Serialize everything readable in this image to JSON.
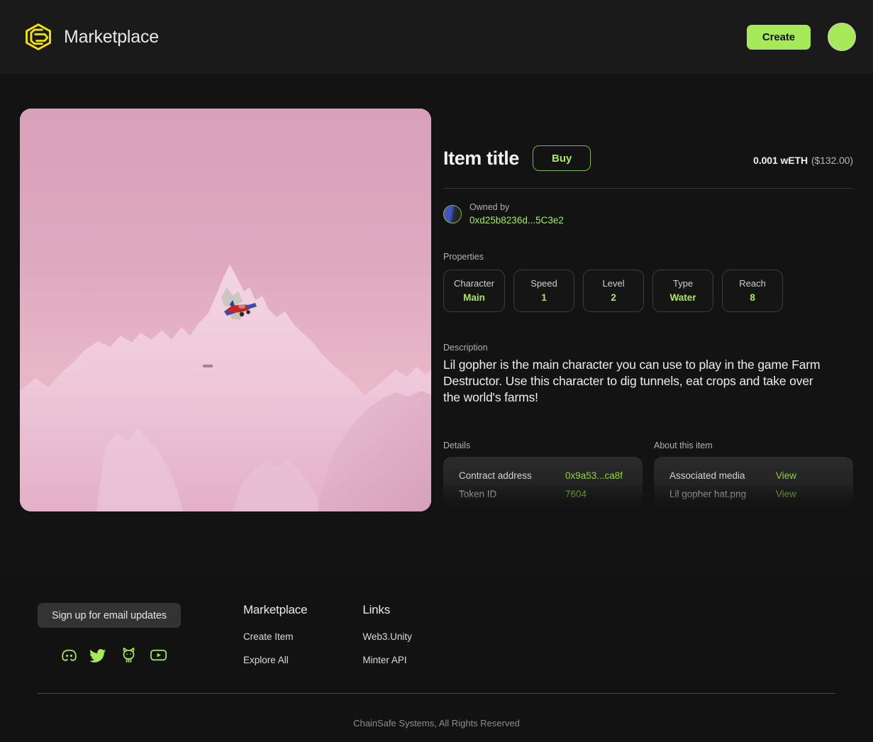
{
  "header": {
    "logo_icon": "chainsafe-hexagon-logo",
    "brand_title": "Marketplace",
    "create_label": "Create",
    "avatar_icon": "user-avatar"
  },
  "media": {
    "alt": "low-poly pink mountain landscape with red airplane",
    "sky_color": "#d8a0b9",
    "mountain_color": "#f0cbdc",
    "plane_body_color": "#cc2222",
    "plane_wing_color": "#3a4ba8"
  },
  "item": {
    "title": "Item title",
    "buy_label": "Buy",
    "price_crypto": "0.001 wETH",
    "price_fiat": "($132.00)",
    "owned_by_label": "Owned by",
    "owner_address": "0xd25b8236d...5C3e2"
  },
  "properties": {
    "label": "Properties",
    "items": [
      {
        "key": "Character",
        "value": "Main"
      },
      {
        "key": "Speed",
        "value": "1"
      },
      {
        "key": "Level",
        "value": "2"
      },
      {
        "key": "Type",
        "value": "Water"
      },
      {
        "key": "Reach",
        "value": "8"
      }
    ]
  },
  "description": {
    "label": "Description",
    "text": "Lil gopher is the main character you can use to play in the game Farm Destructor. Use this character to dig tunnels, eat crops and take over the world's farms!"
  },
  "details": {
    "title": "Details",
    "rows": [
      {
        "key": "Contract address",
        "value": "0x9a53...ca8f"
      },
      {
        "key": "Token ID",
        "value": "7604"
      }
    ]
  },
  "about": {
    "title": "About this item",
    "rows": [
      {
        "key": "Associated media",
        "value": "View"
      },
      {
        "key": "Lil gopher hat.png",
        "value": "View"
      }
    ]
  },
  "footer": {
    "signup_label": "Sign up for email updates",
    "socials": [
      {
        "name": "discord-icon"
      },
      {
        "name": "twitter-icon"
      },
      {
        "name": "github-icon"
      },
      {
        "name": "youtube-icon"
      }
    ],
    "columns": [
      {
        "heading": "Marketplace",
        "links": [
          "Create Item",
          "Explore All"
        ]
      },
      {
        "heading": "Links",
        "links": [
          "Web3.Unity",
          "Minter API"
        ]
      }
    ],
    "copyright": "ChainSafe Systems, All Rights Reserved"
  },
  "colors": {
    "accent_green": "#a6ea59",
    "logo_yellow": "#f5e400",
    "background": "#131313",
    "header_bg": "#1a1a1a"
  }
}
